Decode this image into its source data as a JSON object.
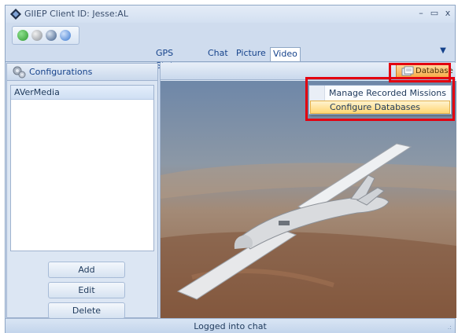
{
  "window": {
    "title": "GIIEP Client ID: Jesse:AL",
    "minimize_glyph": "–",
    "maximize_glyph": "▭",
    "close_glyph": "x"
  },
  "quick_access": [
    {
      "icon": "green-status-icon",
      "color": "#2f9a2f"
    },
    {
      "icon": "gear-icon",
      "color": "#8a9098"
    },
    {
      "icon": "globe-icon",
      "color": "#3b5a86"
    },
    {
      "icon": "help-icon",
      "color": "#3a78d0"
    }
  ],
  "tabs": [
    {
      "label": "GPS Status"
    },
    {
      "label": "Chat"
    },
    {
      "label": "Picture"
    },
    {
      "label": "Video",
      "active": true
    }
  ],
  "ribbon_menu_glyph": "▼",
  "left_panel": {
    "title": "Configurations",
    "items": [
      {
        "label": "AVerMedia",
        "selected": true
      }
    ],
    "buttons": {
      "add": "Add",
      "edit": "Edit",
      "delete": "Delete"
    }
  },
  "video_panel": {
    "database_button": "Database",
    "dropdown": [
      {
        "label": "Manage Recorded Missions"
      },
      {
        "label": "Configure Databases",
        "hover": true
      }
    ]
  },
  "status": {
    "text": "Logged into chat",
    "grip": ".:"
  },
  "colors": {
    "highlight_box": "#e3000f",
    "database_button": "#f7a53f",
    "sky_top": "#6e87a8",
    "ground": "#9a6a4a"
  }
}
